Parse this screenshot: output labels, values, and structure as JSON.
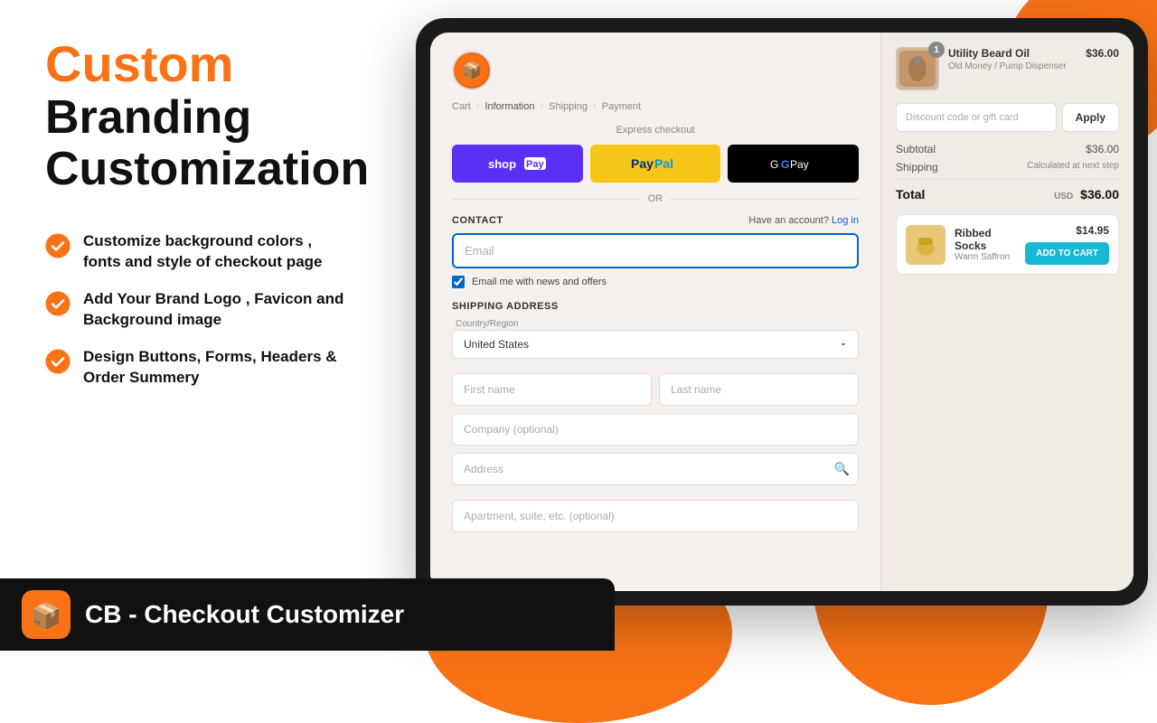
{
  "shapes": {
    "top_right": "decorative circle top right",
    "bottom_right": "decorative circle bottom right",
    "bottom_center": "decorative ellipse bottom center"
  },
  "left_panel": {
    "heading_orange": "Custom",
    "heading_black_1": "Branding",
    "heading_black_2": "Customization",
    "features": [
      {
        "id": "feature-1",
        "text": "Customize background colors , fonts and style of checkout page"
      },
      {
        "id": "feature-2",
        "text": "Add Your Brand Logo , Favicon and Background image"
      },
      {
        "id": "feature-3",
        "text": "Design Buttons, Forms, Headers & Order Summery"
      }
    ]
  },
  "bottom_bar": {
    "brand_name": "CB - Checkout Customizer"
  },
  "checkout": {
    "breadcrumb": {
      "cart": "Cart",
      "information": "Information",
      "shipping": "Shipping",
      "payment": "Payment"
    },
    "express_checkout": {
      "label": "Express checkout"
    },
    "or_text": "OR",
    "contact_section": {
      "title": "CONTACT",
      "have_account_text": "Have an account?",
      "login_text": "Log in",
      "email_placeholder": "Email",
      "checkbox_label": "Email me with news and offers"
    },
    "shipping_section": {
      "title": "SHIPPING ADDRESS",
      "country_label": "Country/Region",
      "country_value": "United States",
      "first_name_placeholder": "First name",
      "last_name_placeholder": "Last name",
      "company_placeholder": "Company (optional)",
      "address_placeholder": "Address",
      "apt_placeholder": "Apartment, suite, etc. (optional)"
    }
  },
  "order_summary": {
    "product": {
      "name": "Utility Beard Oil",
      "variant": "Old Money / Pump Dispenser",
      "price": "$36.00",
      "badge": "1"
    },
    "discount_placeholder": "Discount code or gift card",
    "apply_button": "Apply",
    "subtotal_label": "Subtotal",
    "subtotal_value": "$36.00",
    "shipping_label": "Shipping",
    "shipping_value": "Calculated at next step",
    "total_label": "Total",
    "total_currency": "USD",
    "total_value": "$36.00",
    "upsell": {
      "name": "Ribbed Socks",
      "variant": "Warm Saffron",
      "price": "$14.95",
      "add_to_cart": "ADD TO CART"
    }
  },
  "brand_logo_emoji": "📦"
}
